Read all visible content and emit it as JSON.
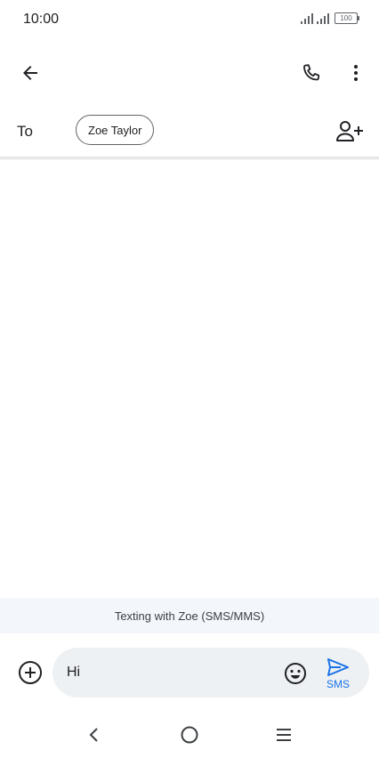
{
  "status_bar": {
    "time": "10:00",
    "battery": "100",
    "icons": [
      "signal-icon",
      "signal-icon",
      "battery-icon"
    ]
  },
  "app_bar": {
    "icons": [
      "arrow-left-icon",
      "phone-icon",
      "more-vert-icon"
    ]
  },
  "recipients": {
    "to_label": "To",
    "chips": [
      "Zoe Taylor"
    ],
    "add_icon": "person-add-icon"
  },
  "banner": {
    "text": "Texting with Zoe (SMS/MMS)"
  },
  "composer": {
    "message_value": "Hi",
    "send_label": "SMS",
    "icons": [
      "add-circle-icon",
      "emoji-icon",
      "send-icon"
    ]
  },
  "nav_bar": {
    "icons": [
      "nav-back-icon",
      "nav-home-icon",
      "nav-menu-icon"
    ]
  },
  "colors": {
    "accent": "#1a73e8",
    "banner_background": "#f3f6fb",
    "input_background": "#eef1f4",
    "text": "#202124"
  }
}
